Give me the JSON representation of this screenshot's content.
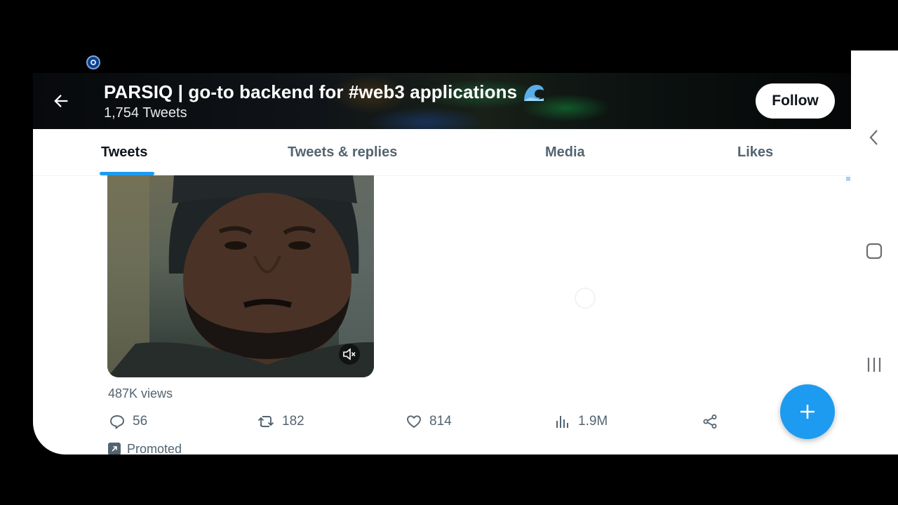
{
  "header": {
    "title": "PARSIQ | go-to backend for #web3 applications",
    "tweet_count": "1,754 Tweets",
    "follow_label": "Follow",
    "title_emoji_icon": "water-wave-icon"
  },
  "tabs": [
    {
      "label": "Tweets",
      "active": true
    },
    {
      "label": "Tweets & replies",
      "active": false
    },
    {
      "label": "Media",
      "active": false
    },
    {
      "label": "Likes",
      "active": false
    }
  ],
  "tweet": {
    "views": "487K views",
    "replies": "56",
    "retweets": "182",
    "likes": "814",
    "impressions": "1.9M",
    "promoted_label": "Promoted"
  },
  "colors": {
    "accent": "#1d9bf0",
    "text_secondary": "#536471",
    "text_primary": "#0f1419"
  },
  "system_nav": {
    "icons": [
      "back-icon",
      "home-icon",
      "recents-icon"
    ]
  }
}
